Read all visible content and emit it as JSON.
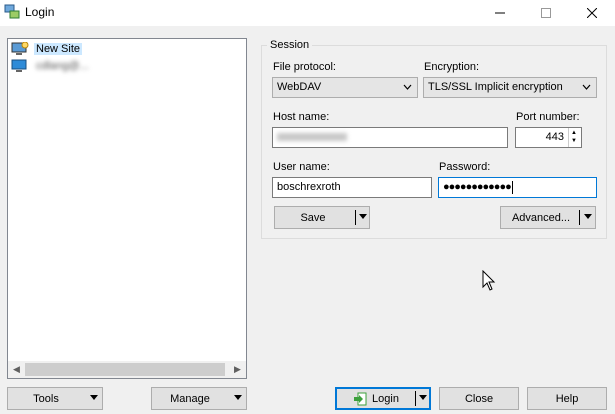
{
  "window": {
    "title": "Login"
  },
  "sites": {
    "items": [
      {
        "label": "New Site",
        "icon": "new-site-icon",
        "selected": true
      },
      {
        "label": "cdlang@...",
        "icon": "monitor-icon",
        "selected": false
      }
    ]
  },
  "session": {
    "legend": "Session",
    "file_protocol": {
      "label": "File protocol:",
      "value": "WebDAV"
    },
    "encryption": {
      "label": "Encryption:",
      "value": "TLS/SSL Implicit encryption"
    },
    "host": {
      "label": "Host name:",
      "value": ""
    },
    "port": {
      "label": "Port number:",
      "value": "443"
    },
    "user": {
      "label": "User name:",
      "value": "boschrexroth"
    },
    "password": {
      "label": "Password:",
      "value": "●●●●●●●●●●●●"
    },
    "save_label": "Save",
    "advanced_label": "Advanced..."
  },
  "footer": {
    "tools_label": "Tools",
    "manage_label": "Manage",
    "login_label": "Login",
    "close_label": "Close",
    "help_label": "Help"
  },
  "colors": {
    "accent": "#0078d7",
    "selection": "#cce8ff",
    "login_icon": "#3ca03c"
  }
}
